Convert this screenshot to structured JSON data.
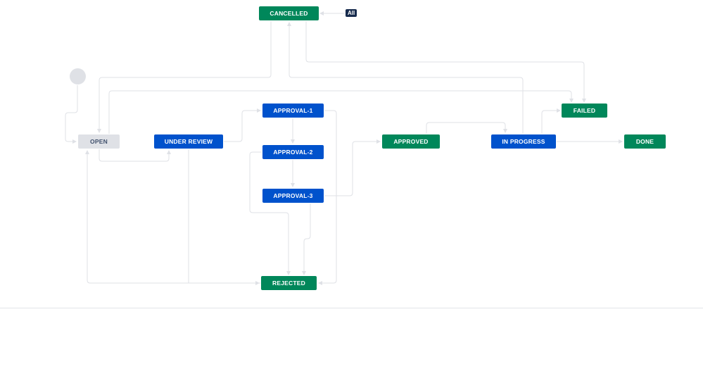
{
  "diagram": {
    "all_badge": "All",
    "statuses": {
      "cancelled": "CANCELLED",
      "open": "OPEN",
      "under_review": "UNDER REVIEW",
      "approval_1": "APPROVAL-1",
      "approval_2": "APPROVAL-2",
      "approval_3": "APPROVAL-3",
      "approved": "APPROVED",
      "in_progress": "IN PROGRESS",
      "failed": "FAILED",
      "done": "DONE",
      "rejected": "REJECTED"
    },
    "colors": {
      "done_category": "#00875a",
      "in_progress_category": "#0052cc",
      "todo_category": "#dfe1e6",
      "edge": "#dfe1e6",
      "badge": "#172b4d"
    }
  }
}
